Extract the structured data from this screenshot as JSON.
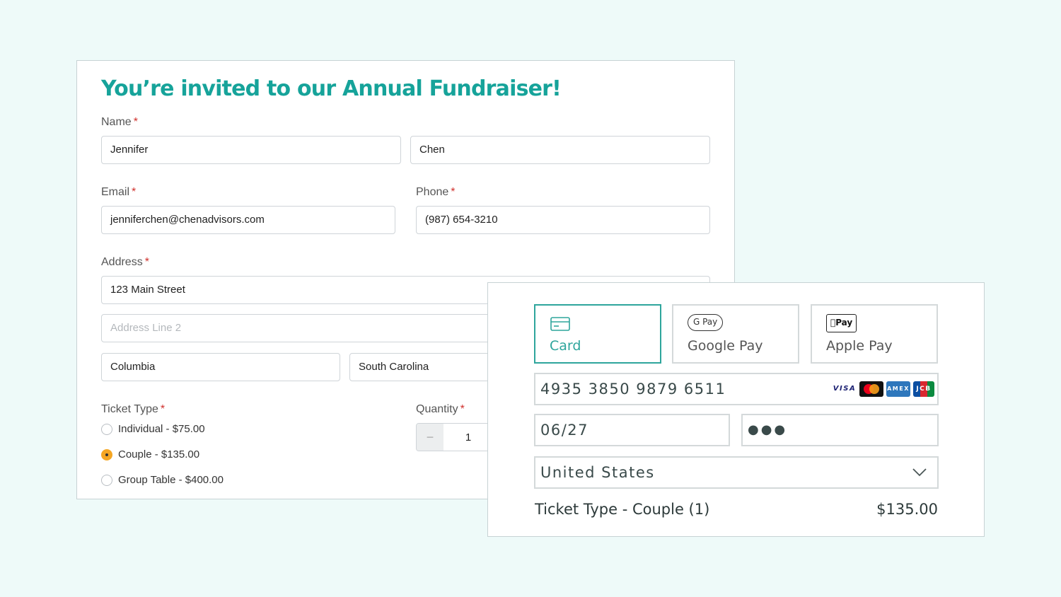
{
  "form": {
    "title": "You’re invited to our Annual Fundraiser!",
    "required_mark": "*",
    "name": {
      "label": "Name",
      "first_value": "Jennifer",
      "last_value": "Chen"
    },
    "email": {
      "label": "Email",
      "value": "jenniferchen@chenadvisors.com"
    },
    "phone": {
      "label": "Phone",
      "value": "(987) 654-3210"
    },
    "address": {
      "label": "Address",
      "line1_value": "123 Main Street",
      "line2_placeholder": "Address Line 2",
      "city_value": "Columbia",
      "state_value": "South Carolina"
    },
    "ticket_type": {
      "label": "Ticket Type",
      "options": [
        {
          "label": "Individual - $75.00",
          "checked": false
        },
        {
          "label": "Couple - $135.00",
          "checked": true
        },
        {
          "label": "Group Table - $400.00",
          "checked": false
        }
      ]
    },
    "quantity": {
      "label": "Quantity",
      "decrement_glyph": "−",
      "value": "1"
    }
  },
  "payment": {
    "methods": [
      {
        "label": "Card",
        "icon": "credit-card-icon",
        "selected": true
      },
      {
        "label": "Google Pay",
        "icon": "google-pay-badge",
        "badge_text": "G Pay",
        "selected": false
      },
      {
        "label": "Apple Pay",
        "icon": "apple-pay-badge",
        "badge_text": "Pay",
        "selected": false
      }
    ],
    "card_number": "4935 3850 9879 6511",
    "card_brands": [
      "VISA",
      "Mastercard",
      "AMEX",
      "JCB"
    ],
    "expiry": "06/27",
    "cvc_masked": "●●●",
    "country": "United States",
    "summary": {
      "label": "Ticket Type - Couple (1)",
      "price": "$135.00"
    }
  },
  "colors": {
    "background": "#eefaf9",
    "title_teal": "#16a39a",
    "selected_teal": "#2ea59c",
    "radio_checked": "#f5a623",
    "required_red": "#d0312d"
  }
}
